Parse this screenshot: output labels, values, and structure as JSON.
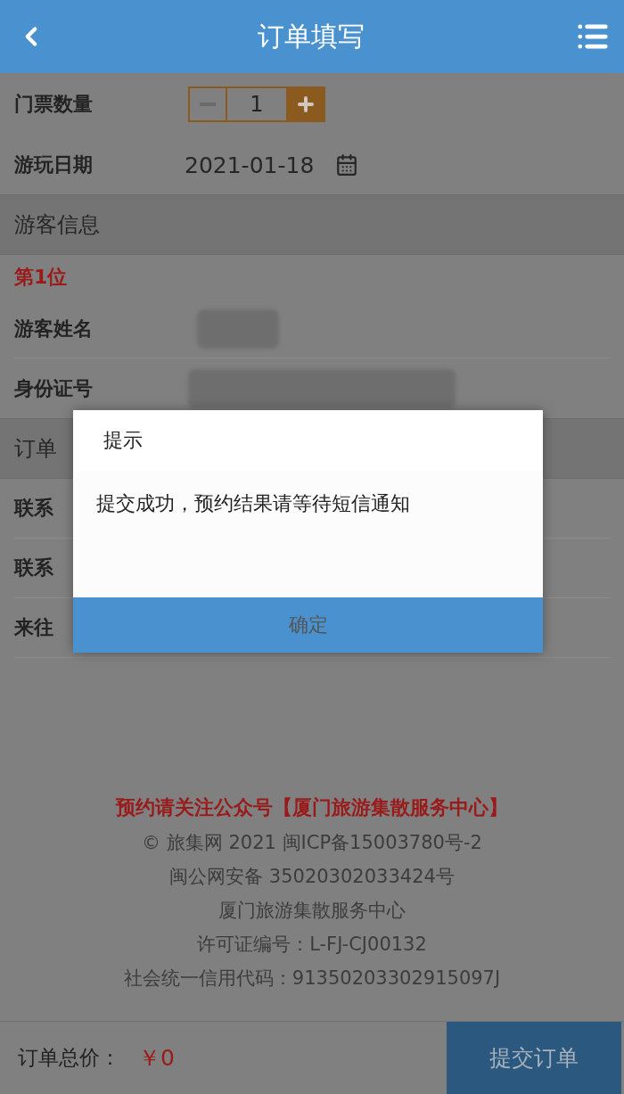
{
  "header": {
    "title": "订单填写"
  },
  "ticket": {
    "label": "门票数量",
    "value": "1"
  },
  "date": {
    "label": "游玩日期",
    "value": "2021-01-18"
  },
  "visitor_section": {
    "title": "游客信息",
    "index": "第1位",
    "fields": [
      {
        "label": "游客姓名",
        "kind": "redacted"
      },
      {
        "label": "身份证号",
        "kind": "redacted"
      }
    ]
  },
  "order_section": {
    "title": "订单",
    "fields": [
      {
        "label": "联系"
      },
      {
        "label": "联系"
      },
      {
        "label": "来往"
      }
    ]
  },
  "footer": {
    "notice": "预约请关注公众号【厦门旅游集散服务中心】",
    "lines": [
      "© 旅集网 2021 闽ICP备15003780号-2",
      "闽公网安备 35020302033424号",
      "厦门旅游集散服务中心",
      "许可证编号：L-FJ-CJ00132",
      "社会统一信用代码：91350203302915097J"
    ]
  },
  "bottom_bar": {
    "total_label": "订单总价：",
    "total_value": "￥0",
    "submit": "提交订单"
  },
  "dialog": {
    "title": "提示",
    "message": "提交成功，预约结果请等待短信通知",
    "button": "确定"
  }
}
